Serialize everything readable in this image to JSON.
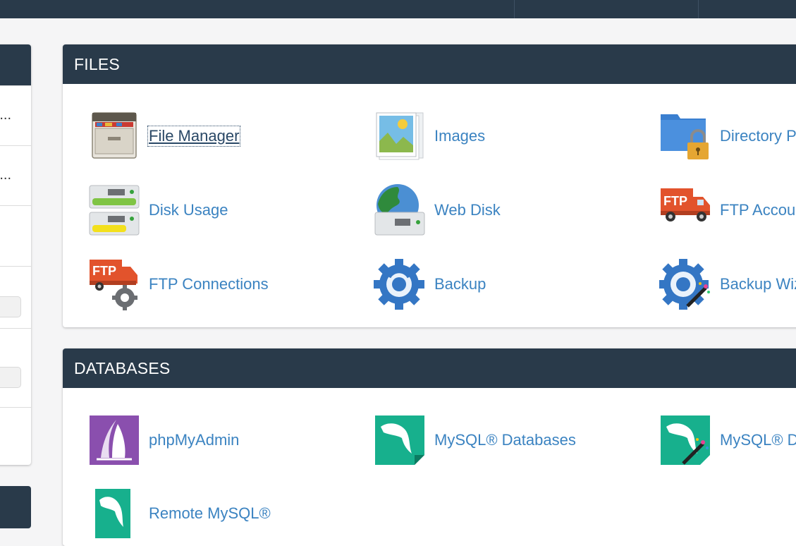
{
  "files": {
    "title": "FILES",
    "items": [
      {
        "label": "File Manager",
        "icon": "file-cabinet-icon"
      },
      {
        "label": "Images",
        "icon": "images-icon"
      },
      {
        "label": "Directory P",
        "icon": "directory-privacy-icon"
      },
      {
        "label": "Disk Usage",
        "icon": "disk-usage-icon"
      },
      {
        "label": "Web Disk",
        "icon": "web-disk-icon"
      },
      {
        "label": "FTP Accour",
        "icon": "ftp-truck-icon"
      },
      {
        "label": "FTP Connections",
        "icon": "ftp-connections-icon"
      },
      {
        "label": "Backup",
        "icon": "backup-gear-icon"
      },
      {
        "label": "Backup Wiz",
        "icon": "backup-wizard-icon"
      }
    ]
  },
  "databases": {
    "title": "DATABASES",
    "items": [
      {
        "label": "phpMyAdmin",
        "icon": "phpmyadmin-icon"
      },
      {
        "label": "MySQL® Databases",
        "icon": "mysql-dolphin-icon"
      },
      {
        "label": "MySQL® D",
        "icon": "mysql-wizard-icon"
      },
      {
        "label": "Remote MySQL®",
        "icon": "remote-mysql-icon"
      }
    ]
  },
  "sidebar": {
    "rows": [
      "...",
      "o..."
    ]
  },
  "colors": {
    "header": "#293a4a",
    "link": "#3b83c1",
    "background": "#f5f5f6"
  }
}
